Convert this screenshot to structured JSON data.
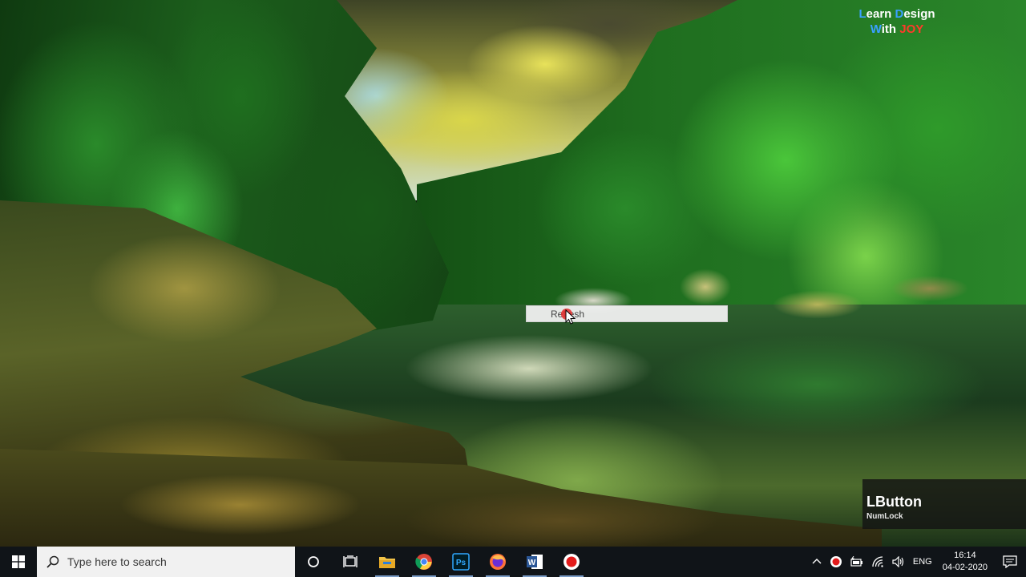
{
  "desktop": {
    "context_menu_item": "Refresh"
  },
  "watermark": {
    "line1_prefix_l": "L",
    "line1_rest_1": "earn ",
    "line1_d": "D",
    "line1_rest_2": "esign",
    "line2_w": "W",
    "line2_rest": "ith ",
    "line2_joy": "JOY"
  },
  "key_overlay": {
    "key": "LButton",
    "modifier": "NumLock"
  },
  "taskbar": {
    "search_placeholder": "Type here to search",
    "pinned_apps": [
      {
        "name": "file-explorer-icon"
      },
      {
        "name": "chrome-icon"
      },
      {
        "name": "photoshop-icon",
        "label": "Ps"
      },
      {
        "name": "firefox-icon"
      },
      {
        "name": "word-icon",
        "label": "W"
      },
      {
        "name": "recorder-icon"
      }
    ],
    "tray": {
      "language": "ENG",
      "time": "16:14",
      "date": "04-02-2020"
    }
  },
  "colors": {
    "taskbar_bg": "#101418",
    "accent_blue": "#3aa0ff",
    "accent_red": "#ff3a2a"
  }
}
